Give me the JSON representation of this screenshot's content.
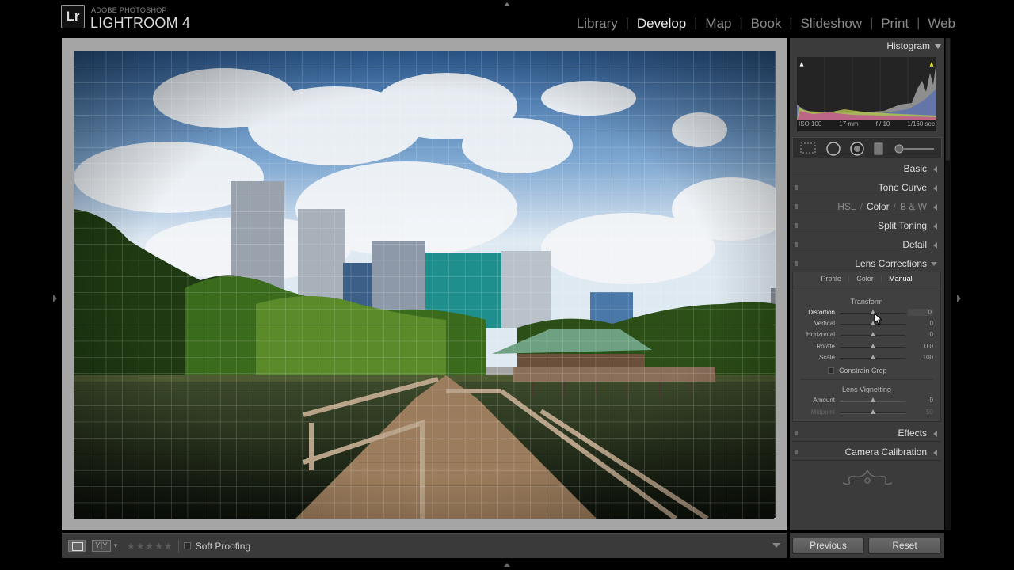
{
  "app": {
    "logo": "Lr",
    "brand_small": "ADOBE PHOTOSHOP",
    "brand_big": "LIGHTROOM 4"
  },
  "modules": [
    {
      "label": "Library",
      "active": false
    },
    {
      "label": "Develop",
      "active": true
    },
    {
      "label": "Map",
      "active": false
    },
    {
      "label": "Book",
      "active": false
    },
    {
      "label": "Slideshow",
      "active": false
    },
    {
      "label": "Print",
      "active": false
    },
    {
      "label": "Web",
      "active": false
    }
  ],
  "toolbar": {
    "before_after": "Y|Y",
    "soft_proofing": "Soft Proofing",
    "stars": [
      "★",
      "★",
      "★",
      "★",
      "★"
    ]
  },
  "histogram": {
    "title": "Histogram",
    "iso": "ISO 100",
    "focal": "17 mm",
    "aperture": "f / 10",
    "shutter": "1/160 sec"
  },
  "panels": {
    "basic": "Basic",
    "tone_curve": "Tone Curve",
    "hsl": "HSL",
    "color": "Color",
    "bw": "B & W",
    "split_toning": "Split Toning",
    "detail": "Detail",
    "lens_corrections": "Lens Corrections",
    "effects": "Effects",
    "camera_calibration": "Camera Calibration"
  },
  "lens": {
    "tabs": [
      "Profile",
      "Color",
      "Manual"
    ],
    "active_tab": "Manual",
    "transform_title": "Transform",
    "sliders": [
      {
        "label": "Distortion",
        "value": "0",
        "pos": 0.5
      },
      {
        "label": "Vertical",
        "value": "0",
        "pos": 0.5
      },
      {
        "label": "Horizontal",
        "value": "0",
        "pos": 0.5
      },
      {
        "label": "Rotate",
        "value": "0.0",
        "pos": 0.5
      },
      {
        "label": "Scale",
        "value": "100",
        "pos": 0.5
      }
    ],
    "constrain_crop": "Constrain Crop",
    "vignetting_title": "Lens Vignetting",
    "vignette": [
      {
        "label": "Amount",
        "value": "0",
        "pos": 0.5
      },
      {
        "label": "Midpoint",
        "value": "50",
        "pos": 0.5
      }
    ]
  },
  "buttons": {
    "previous": "Previous",
    "reset": "Reset"
  },
  "colors": {
    "panel_bg": "#3b3b3b",
    "canvas_bg": "#a5a5a5",
    "active_module": "#eeeeee",
    "inactive_module": "#8a8a8a"
  }
}
